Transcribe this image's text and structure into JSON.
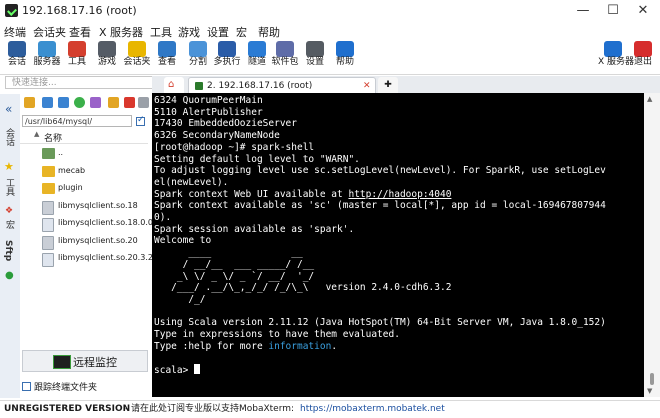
{
  "window": {
    "title": "192.168.17.16 (root)"
  },
  "menu": [
    "终端",
    "会话夹",
    "查看",
    "X 服务器",
    "工具",
    "游戏",
    "设置",
    "宏",
    "帮助"
  ],
  "toolbar": [
    {
      "label": "会话",
      "color": "#2d5d9c"
    },
    {
      "label": "服务器",
      "color": "#3a8fd0"
    },
    {
      "label": "工具",
      "color": "#d43f2e"
    },
    {
      "label": "游戏",
      "color": "#555c66"
    },
    {
      "label": "会话夹",
      "color": "#e8b600"
    },
    {
      "label": "查看",
      "color": "#2f78c6"
    },
    {
      "label": "分割",
      "color": "#4b93d8"
    },
    {
      "label": "多执行",
      "color": "#2a5ca8"
    },
    {
      "label": "隧道",
      "color": "#2a7bd4"
    },
    {
      "label": "软件包",
      "color": "#5e6ca8"
    },
    {
      "label": "设置",
      "color": "#555b62"
    },
    {
      "label": "帮助",
      "color": "#1f6fce"
    }
  ],
  "toolbar_right": [
    {
      "label": "X 服务器",
      "color": "#1f6fce"
    },
    {
      "label": "退出",
      "color": "#d62d2d"
    }
  ],
  "quick_connect": {
    "placeholder": "快速连接..."
  },
  "vertical_tabs": [
    "会话",
    "工具",
    "宏",
    "Sftp"
  ],
  "sftp": {
    "path": "/usr/lib64/mysql/",
    "column_name": "名称",
    "files": [
      {
        "name": "..",
        "type": "parent"
      },
      {
        "name": "mecab",
        "type": "folder"
      },
      {
        "name": "plugin",
        "type": "folder"
      },
      {
        "name": "libmysqlclient.so.18",
        "type": "link"
      },
      {
        "name": "libmysqlclient.so.18.0.0",
        "type": "file"
      },
      {
        "name": "libmysqlclient.so.20",
        "type": "link"
      },
      {
        "name": "libmysqlclient.so.20.3.2",
        "type": "file"
      }
    ],
    "remote_monitor": "远程监控",
    "follow_folder": "跟踪终端文件夹"
  },
  "tabs": [
    {
      "label": "2. 192.168.17.16 (root)",
      "active": true
    }
  ],
  "terminal_lines": [
    "6324 QuorumPeerMain",
    "5110 AlertPublisher",
    "17430 EmbeddedOozieServer",
    "6326 SecondaryNameNode",
    "[root@hadoop ~]# spark-shell",
    "Setting default log level to \"WARN\".",
    "To adjust logging level use sc.setLogLevel(newLevel). For SparkR, use setLogLev",
    "el(newLevel).",
    "Spark context Web UI available at http://hadoop:4040",
    "Spark context available as 'sc' (master = local[*], app id = local-169467807944",
    "0).",
    "Spark session available as 'spark'.",
    "Welcome to",
    "      ____              __",
    "     / __/__  ___ _____/ /__",
    "    _\\ \\/ _ \\/ _ `/ __/  '_/",
    "   /___/ .__/\\_,_/_/ /_/\\_\\   version 2.4.0-cdh6.3.2",
    "      /_/",
    "",
    "Using Scala version 2.11.12 (Java HotSpot(TM) 64-Bit Server VM, Java 1.8.0_152)",
    "Type in expressions to have them evaluated.",
    "Type :help for more information.",
    "",
    "scala> "
  ],
  "status": {
    "unregistered": "UNREGISTERED VERSION",
    "message": " - 请在此处订阅专业版以支持MobaXterm: ",
    "url": "https://mobaxterm.mobatek.net"
  }
}
